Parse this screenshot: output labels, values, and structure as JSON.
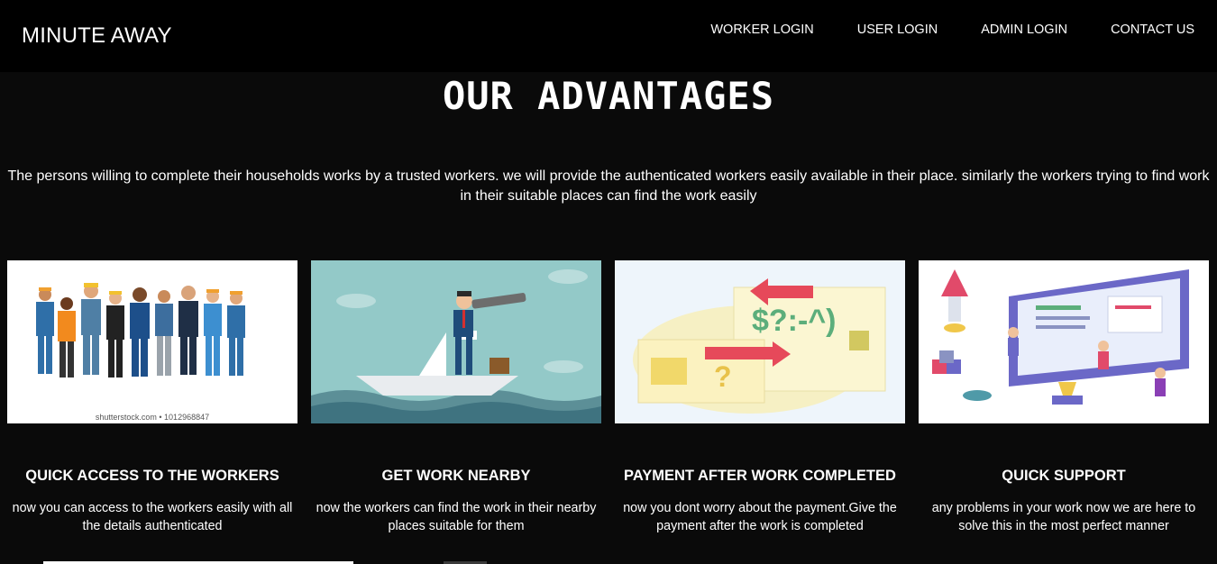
{
  "brand": "MINUTE AWAY",
  "nav": [
    "WORKER LOGIN",
    "USER LOGIN",
    "ADMIN LOGIN",
    "CONTACT US"
  ],
  "heading": "OUR ADVANTAGES",
  "intro_line1": "The persons willing to complete their households works by a trusted workers. we will provide the authenticated workers easily available in their place. similarly the workers trying to find work",
  "intro_line2": "in their suitable places can find the work easily",
  "cards": [
    {
      "title": "QUICK ACCESS TO THE WORKERS",
      "desc1": "now you can access to the workers easily with all",
      "desc2": "the details authenticated",
      "image": "group-of-workers-illustration",
      "watermark": "shutterstock.com • 1012968847"
    },
    {
      "title": "GET WORK NEARBY",
      "desc1": "now the workers can find the work in their nearby",
      "desc2": "places suitable for them",
      "image": "man-with-telescope-on-paper-boat-illustration"
    },
    {
      "title": "PAYMENT AFTER WORK COMPLETED",
      "desc1": "now you dont worry about the payment.Give the",
      "desc2": "payment after the work is completed",
      "image": "payment-transfer-illustration",
      "img_text": "$?:-^)"
    },
    {
      "title": "QUICK SUPPORT",
      "desc1": "any problems in your work now we are here to",
      "desc2": "solve this in the most perfect manner",
      "image": "support-team-dashboard-illustration"
    }
  ]
}
